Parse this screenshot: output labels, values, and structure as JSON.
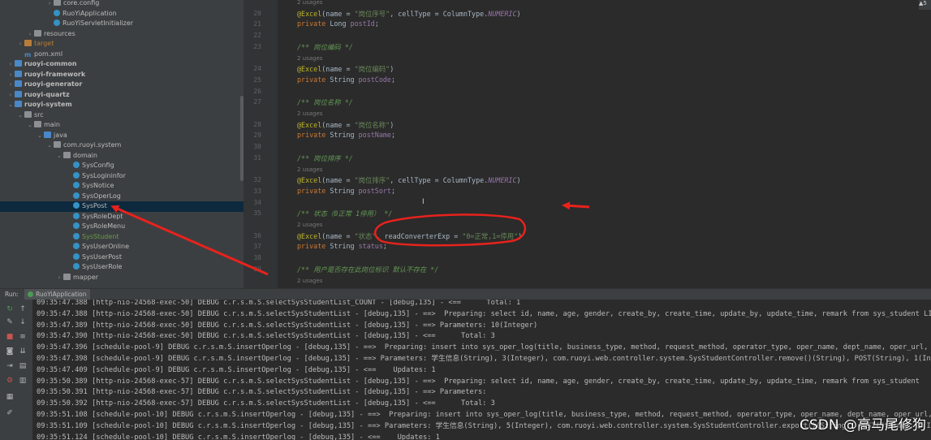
{
  "tree": {
    "items": [
      {
        "label": "core.config",
        "indent": 5,
        "arrow": "›",
        "icon": "folder",
        "style": ""
      },
      {
        "label": "RuoYiApplication",
        "indent": 5,
        "arrow": "",
        "icon": "cls",
        "style": ""
      },
      {
        "label": "RuoYiServletInitializer",
        "indent": 5,
        "arrow": "",
        "icon": "cls",
        "style": ""
      },
      {
        "label": "resources",
        "indent": 3,
        "arrow": "›",
        "icon": "folder",
        "style": ""
      },
      {
        "label": "target",
        "indent": 2,
        "arrow": "›",
        "icon": "folder orange",
        "style": "orange"
      },
      {
        "label": "pom.xml",
        "indent": 2,
        "arrow": "",
        "icon": "pom",
        "style": ""
      },
      {
        "label": "ruoyi-common",
        "indent": 1,
        "arrow": "›",
        "icon": "folder blue",
        "style": "bold"
      },
      {
        "label": "ruoyi-framework",
        "indent": 1,
        "arrow": "›",
        "icon": "folder blue",
        "style": "bold"
      },
      {
        "label": "ruoyi-generator",
        "indent": 1,
        "arrow": "›",
        "icon": "folder blue",
        "style": "bold"
      },
      {
        "label": "ruoyi-quartz",
        "indent": 1,
        "arrow": "›",
        "icon": "folder blue",
        "style": "bold"
      },
      {
        "label": "ruoyi-system",
        "indent": 1,
        "arrow": "⌄",
        "icon": "folder blue",
        "style": "bold"
      },
      {
        "label": "src",
        "indent": 2,
        "arrow": "⌄",
        "icon": "folder",
        "style": ""
      },
      {
        "label": "main",
        "indent": 3,
        "arrow": "⌄",
        "icon": "folder",
        "style": ""
      },
      {
        "label": "java",
        "indent": 4,
        "arrow": "⌄",
        "icon": "folder blue",
        "style": ""
      },
      {
        "label": "com.ruoyi.system",
        "indent": 5,
        "arrow": "⌄",
        "icon": "folder",
        "style": ""
      },
      {
        "label": "domain",
        "indent": 6,
        "arrow": "⌄",
        "icon": "folder",
        "style": ""
      },
      {
        "label": "SysConfig",
        "indent": 7,
        "arrow": "",
        "icon": "cls",
        "style": ""
      },
      {
        "label": "SysLogininfor",
        "indent": 7,
        "arrow": "",
        "icon": "cls",
        "style": ""
      },
      {
        "label": "SysNotice",
        "indent": 7,
        "arrow": "",
        "icon": "cls",
        "style": ""
      },
      {
        "label": "SysOperLog",
        "indent": 7,
        "arrow": "",
        "icon": "cls",
        "style": ""
      },
      {
        "label": "SysPost",
        "indent": 7,
        "arrow": "",
        "icon": "cls",
        "style": "",
        "selected": true
      },
      {
        "label": "SysRoleDept",
        "indent": 7,
        "arrow": "",
        "icon": "cls",
        "style": ""
      },
      {
        "label": "SysRoleMenu",
        "indent": 7,
        "arrow": "",
        "icon": "cls",
        "style": ""
      },
      {
        "label": "SysStudent",
        "indent": 7,
        "arrow": "",
        "icon": "cls",
        "style": "green"
      },
      {
        "label": "SysUserOnline",
        "indent": 7,
        "arrow": "",
        "icon": "cls",
        "style": ""
      },
      {
        "label": "SysUserPost",
        "indent": 7,
        "arrow": "",
        "icon": "cls",
        "style": ""
      },
      {
        "label": "SysUserRole",
        "indent": 7,
        "arrow": "",
        "icon": "cls",
        "style": ""
      },
      {
        "label": "mapper",
        "indent": 6,
        "arrow": "›",
        "icon": "folder",
        "style": ""
      }
    ]
  },
  "editor": {
    "lines": [
      {
        "ln": "",
        "kind": "usage",
        "text": "2 usages"
      },
      {
        "ln": "20",
        "kind": "code",
        "parts": [
          [
            "ann",
            "@Excel"
          ],
          [
            "",
            "(name = "
          ],
          [
            "str",
            "\"岗位序号\""
          ],
          [
            "",
            ", cellType = ColumnType."
          ],
          [
            "cst",
            "NUMERIC"
          ],
          [
            "",
            ")"
          ]
        ]
      },
      {
        "ln": "21",
        "kind": "code",
        "parts": [
          [
            "kw",
            "private "
          ],
          [
            "",
            "Long "
          ],
          [
            "fld",
            "postId"
          ],
          [
            "",
            ";"
          ]
        ]
      },
      {
        "ln": "22",
        "kind": "code",
        "parts": []
      },
      {
        "ln": "23",
        "kind": "cmt",
        "text": "/** 岗位编码 */"
      },
      {
        "ln": "",
        "kind": "usage",
        "text": "2 usages"
      },
      {
        "ln": "24",
        "kind": "code",
        "parts": [
          [
            "ann",
            "@Excel"
          ],
          [
            "",
            "(name = "
          ],
          [
            "str",
            "\"岗位编码\""
          ],
          [
            "",
            ")"
          ]
        ]
      },
      {
        "ln": "25",
        "kind": "code",
        "parts": [
          [
            "kw",
            "private "
          ],
          [
            "",
            "String "
          ],
          [
            "fld",
            "postCode"
          ],
          [
            "",
            ";"
          ]
        ]
      },
      {
        "ln": "26",
        "kind": "code",
        "parts": []
      },
      {
        "ln": "27",
        "kind": "cmt",
        "text": "/** 岗位名称 */"
      },
      {
        "ln": "",
        "kind": "usage",
        "text": "2 usages"
      },
      {
        "ln": "28",
        "kind": "code",
        "parts": [
          [
            "ann",
            "@Excel"
          ],
          [
            "",
            "(name = "
          ],
          [
            "str",
            "\"岗位名称\""
          ],
          [
            "",
            ")"
          ]
        ]
      },
      {
        "ln": "29",
        "kind": "code",
        "parts": [
          [
            "kw",
            "private "
          ],
          [
            "",
            "String "
          ],
          [
            "fld",
            "postName"
          ],
          [
            "",
            ";"
          ]
        ]
      },
      {
        "ln": "30",
        "kind": "code",
        "parts": []
      },
      {
        "ln": "31",
        "kind": "cmt",
        "text": "/** 岗位排序 */"
      },
      {
        "ln": "",
        "kind": "usage",
        "text": "2 usages"
      },
      {
        "ln": "32",
        "kind": "code",
        "parts": [
          [
            "ann",
            "@Excel"
          ],
          [
            "",
            "(name = "
          ],
          [
            "str",
            "\"岗位排序\""
          ],
          [
            "",
            ", cellType = ColumnType."
          ],
          [
            "cst",
            "NUMERIC"
          ],
          [
            "",
            ")"
          ]
        ]
      },
      {
        "ln": "33",
        "kind": "code",
        "parts": [
          [
            "kw",
            "private "
          ],
          [
            "",
            "String "
          ],
          [
            "fld",
            "postSort"
          ],
          [
            "",
            ";"
          ]
        ]
      },
      {
        "ln": "34",
        "kind": "code",
        "parts": []
      },
      {
        "ln": "35",
        "kind": "cmt",
        "text": "/** 状态（0正常 1停用） */"
      },
      {
        "ln": "",
        "kind": "usage",
        "text": "2 usages"
      },
      {
        "ln": "36",
        "kind": "code",
        "parts": [
          [
            "ann",
            "@Excel"
          ],
          [
            "",
            "(name = "
          ],
          [
            "str",
            "\"状态\""
          ],
          [
            "",
            ", readConverterExp = "
          ],
          [
            "str",
            "\"0=正常,1=停用\""
          ],
          [
            "",
            ")"
          ]
        ]
      },
      {
        "ln": "37",
        "kind": "code",
        "parts": [
          [
            "kw",
            "private "
          ],
          [
            "",
            "String "
          ],
          [
            "fld",
            "status"
          ],
          [
            "",
            ";"
          ]
        ]
      },
      {
        "ln": "38",
        "kind": "code",
        "parts": []
      },
      {
        "ln": "39",
        "kind": "cmt",
        "text": "/** 用户是否存在此岗位标识 默认不存在 */"
      },
      {
        "ln": "",
        "kind": "usage",
        "text": "2 usages"
      }
    ]
  },
  "run": {
    "label": "Run:",
    "tab": "RuoYiApplication"
  },
  "console": {
    "lines": [
      "09:35:47.388 [http-nio-24568-exec-50] DEBUG c.r.s.m.S.selectSysStudentList_COUNT - [debug,135] - <==      Total: 1",
      "09:35:47.388 [http-nio-24568-exec-50] DEBUG c.r.s.m.S.selectSysStudentList - [debug,135] - ==>  Preparing: select id, name, age, gender, create_by, create_time, update_by, update_time, remark from sys_student LIMIT ?",
      "09:35:47.389 [http-nio-24568-exec-50] DEBUG c.r.s.m.S.selectSysStudentList - [debug,135] - ==> Parameters: 10(Integer)",
      "09:35:47.390 [http-nio-24568-exec-50] DEBUG c.r.s.m.S.selectSysStudentList - [debug,135] - <==      Total: 3",
      "09:35:47.396 [schedule-pool-9] DEBUG c.r.s.m.S.insertOperlog - [debug,135] - ==>  Preparing: insert into sys_oper_log(title, business_type, method, request_method, operator_type, oper_name, dept_name, oper_url, oper_ip, o",
      "09:35:47.398 [schedule-pool-9] DEBUG c.r.s.m.S.insertOperlog - [debug,135] - ==> Parameters: 学生信息(String), 3(Integer), com.ruoyi.web.controller.system.SysStudentController.remove()(String), POST(String), 1(Integer), ad",
      "09:35:47.409 [schedule-pool-9] DEBUG c.r.s.m.S.insertOperlog - [debug,135] - <==    Updates: 1",
      "09:35:50.389 [http-nio-24568-exec-57] DEBUG c.r.s.m.S.selectSysStudentList - [debug,135] - ==>  Preparing: select id, name, age, gender, create_by, create_time, update_by, update_time, remark from sys_student",
      "09:35:50.391 [http-nio-24568-exec-57] DEBUG c.r.s.m.S.selectSysStudentList - [debug,135] - ==> Parameters: ",
      "09:35:50.392 [http-nio-24568-exec-57] DEBUG c.r.s.m.S.selectSysStudentList - [debug,135] - <==      Total: 3",
      "09:35:51.108 [schedule-pool-10] DEBUG c.r.s.m.S.insertOperlog - [debug,135] - ==>  Preparing: insert into sys_oper_log(title, business_type, method, request_method, operator_type, oper_name, dept_name, oper_url, oper_ip",
      "09:35:51.109 [schedule-pool-10] DEBUG c.r.s.m.S.insertOperlog - [debug,135] - ==> Parameters: 学生信息(String), 5(Integer), com.ruoyi.web.controller.system.SysStudentController.export()(String), POST(String), 1(Integer)",
      "09:35:51.124 [schedule-pool-10] DEBUG c.r.s.m.S.insertOperlog - [debug,135] - <==    Updates: 1"
    ]
  },
  "toolbar": {
    "icons": [
      {
        "name": "rerun-icon",
        "glyph": "↻",
        "color": "#499c54"
      },
      {
        "name": "scroll-up-icon",
        "glyph": "↑",
        "color": "#afb1b3"
      },
      {
        "name": "wrench-icon",
        "glyph": "✎",
        "color": "#afb1b3"
      },
      {
        "name": "scroll-down-icon",
        "glyph": "↓",
        "color": "#afb1b3"
      },
      {
        "name": "stop-icon",
        "glyph": "■",
        "color": "#c75450"
      },
      {
        "name": "soft-wrap-icon",
        "glyph": "≡",
        "color": "#afb1b3"
      },
      {
        "name": "camera-icon",
        "glyph": "◙",
        "color": "#afb1b3"
      },
      {
        "name": "scroll-end-icon",
        "glyph": "⇊",
        "color": "#afb1b3"
      },
      {
        "name": "exit-icon",
        "glyph": "⇥",
        "color": "#afb1b3"
      },
      {
        "name": "print-icon",
        "glyph": "▤",
        "color": "#afb1b3"
      },
      {
        "name": "settings-icon",
        "glyph": "⚙",
        "color": "#c75450"
      },
      {
        "name": "trash-icon",
        "glyph": "▥",
        "color": "#afb1b3"
      },
      {
        "name": "layout-icon",
        "glyph": "▦",
        "color": "#afb1b3"
      },
      {
        "name": "pin-icon",
        "glyph": "✐",
        "color": "#afb1b3"
      }
    ]
  },
  "watermark": "CSDN @高马尾修狗",
  "top_right_badge": "▲5",
  "colors": {
    "annotation_red": "#e8221c"
  }
}
